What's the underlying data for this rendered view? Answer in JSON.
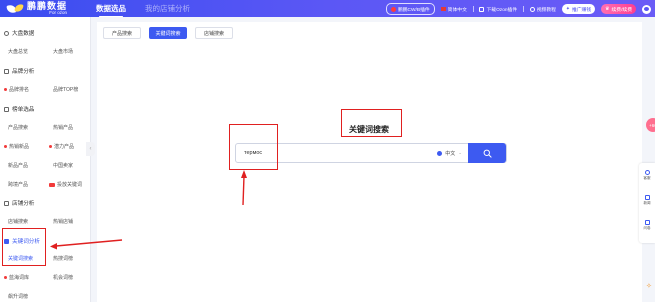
{
  "app": {
    "logo_cn": "鹏鹏数据",
    "logo_en": "For ozon"
  },
  "topnav": {
    "primary": "数据选品",
    "secondary": "我的店铺分析"
  },
  "toolbar_right": {
    "pill1": "鹏鹏CW/B插件",
    "lang": "简体中文",
    "download": "下载Ozon插件",
    "tutorial": "视频教程",
    "brand": "推广赚钱",
    "vip": "续费/续费"
  },
  "sidebar": {
    "sections": [
      {
        "label": "大盘数据",
        "items": [
          "大盘总览",
          "大盘市场"
        ]
      },
      {
        "label": "品牌分析",
        "items": [
          "品牌排名",
          "品牌TOP榜"
        ]
      },
      {
        "label": "榜单选品",
        "items": [
          "产品搜索",
          "热销产品",
          "热销新品",
          "潜力产品",
          "新品产品",
          "中国卖家",
          "跨境产品",
          "投放关键词"
        ]
      },
      {
        "label": "店铺分析",
        "items": [
          "店铺搜索",
          "热销店铺"
        ]
      },
      {
        "label": "关键词分析",
        "items": [
          "关键词搜索",
          "热搜词榜",
          "蓝海词库",
          "机会词榜",
          "飙升词榜"
        ]
      }
    ]
  },
  "main": {
    "tabs": [
      "产品搜索",
      "关键词搜索",
      "店铺搜索"
    ],
    "active_tab": "关键词搜索",
    "search_title": "关键词搜索",
    "search_value": "термос",
    "language": "中文"
  },
  "right_tools": {
    "badge": "+66",
    "items": [
      "客服",
      "新闻",
      "问卷"
    ]
  },
  "colors": {
    "accent": "#3d5af1",
    "annotation": "#e02020"
  }
}
